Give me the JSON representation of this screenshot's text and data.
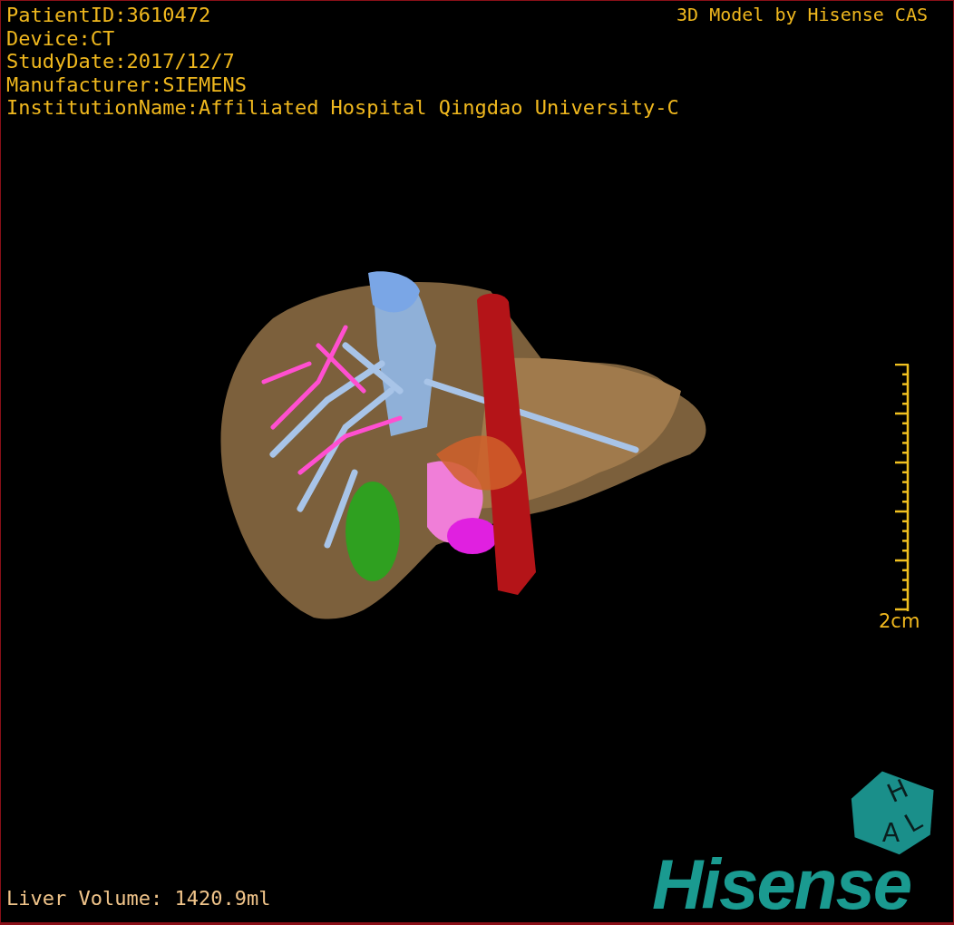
{
  "info_lines": [
    "PatientID:3610472",
    "Device:CT",
    "StudyDate:2017/12/7",
    "Manufacturer:SIEMENS",
    "InstitutionName:Affiliated Hospital Qingdao University-C"
  ],
  "credit": "3D Model by Hisense CAS",
  "scale_label": "2cm",
  "volume": "Liver Volume: 1420.9ml",
  "cube_letters": [
    "H",
    "A",
    "L"
  ],
  "brand": "Hisense"
}
